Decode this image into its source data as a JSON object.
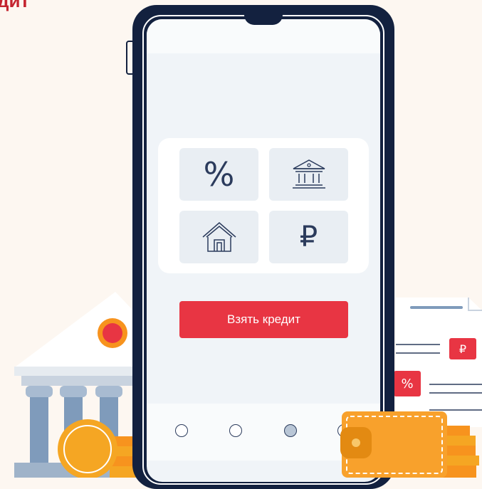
{
  "page": {
    "heading_fragment": "дит"
  },
  "menu": {
    "tiles": [
      {
        "icon": "percent-icon",
        "glyph": "%"
      },
      {
        "icon": "bank-icon"
      },
      {
        "icon": "house-icon"
      },
      {
        "icon": "ruble-icon",
        "glyph": "₽"
      }
    ]
  },
  "cta": {
    "label": "Взять кредит"
  },
  "nav": {
    "dots": 4,
    "active_index": 2
  },
  "document": {
    "ruble_badge": "₽",
    "percent_badge": "%"
  },
  "colors": {
    "brand_red": "#e83543",
    "navy": "#13213f",
    "background": "#fdf7f1",
    "coin_orange": "#f7931e",
    "wallet_orange": "#f8a12c"
  }
}
